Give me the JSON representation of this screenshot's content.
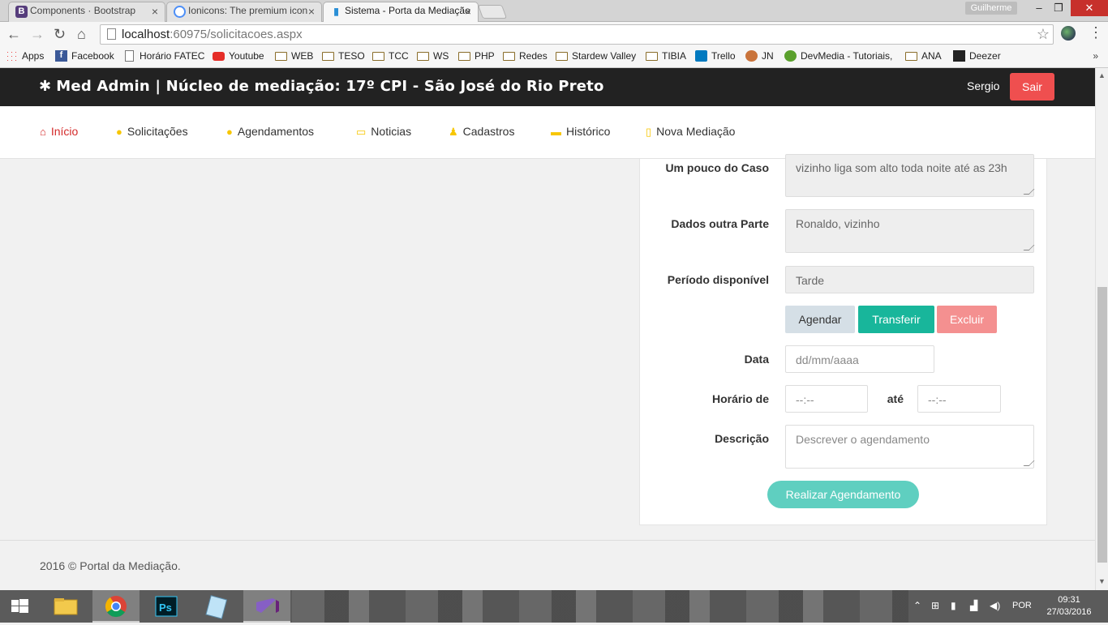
{
  "browser": {
    "tabs": [
      {
        "title": "Components · Bootstrap",
        "favicon": "B",
        "favicon_color": "#563d7c"
      },
      {
        "title": "Ionicons: The premium icon",
        "favicon": "",
        "favicon_color": "#4d8ff7"
      },
      {
        "title": "Sistema - Porta da Mediação",
        "favicon": "",
        "favicon_color": "#2a8fd6"
      }
    ],
    "user_profile": "Guilherme",
    "url_host": "localhost",
    "url_path": ":60975/solicitacoes.aspx",
    "bookmarks": [
      {
        "label": "Apps",
        "icon": "apps-grid-icon"
      },
      {
        "label": "Facebook",
        "icon": "facebook-icon"
      },
      {
        "label": "Horário FATEC",
        "icon": "page-icon"
      },
      {
        "label": "Youtube",
        "icon": "youtube-icon"
      },
      {
        "label": "WEB",
        "icon": "folder-icon"
      },
      {
        "label": "TESO",
        "icon": "folder-icon"
      },
      {
        "label": "TCC",
        "icon": "folder-icon"
      },
      {
        "label": "WS",
        "icon": "folder-icon"
      },
      {
        "label": "PHP",
        "icon": "folder-icon"
      },
      {
        "label": "Redes",
        "icon": "folder-icon"
      },
      {
        "label": "Stardew Valley",
        "icon": "folder-icon"
      },
      {
        "label": "TIBIA",
        "icon": "folder-icon"
      },
      {
        "label": "Trello",
        "icon": "trello-icon"
      },
      {
        "label": "JN",
        "icon": "jn-icon"
      },
      {
        "label": "DevMedia - Tutoriais,",
        "icon": "devmedia-icon"
      },
      {
        "label": "ANA",
        "icon": "folder-icon"
      },
      {
        "label": "Deezer",
        "icon": "deezer-icon"
      }
    ]
  },
  "header": {
    "brand": "Med Admin | Núcleo de mediação: 17º CPI - São José do Rio Preto",
    "user": "Sergio",
    "logout": "Sair"
  },
  "nav": {
    "items": [
      {
        "label": "Início",
        "icon": "home-icon",
        "active": true
      },
      {
        "label": "Solicitações",
        "icon": "circle-icon"
      },
      {
        "label": "Agendamentos",
        "icon": "chat-icon"
      },
      {
        "label": "Noticias",
        "icon": "calendar-icon"
      },
      {
        "label": "Cadastros",
        "icon": "users-icon"
      },
      {
        "label": "Histórico",
        "icon": "folder-icon"
      },
      {
        "label": "Nova Mediação",
        "icon": "document-icon"
      }
    ]
  },
  "form": {
    "caso_label": "Um pouco do Caso",
    "caso_value": "vizinho liga som alto toda noite até as 23h",
    "outra_parte_label": "Dados outra Parte",
    "outra_parte_value": "Ronaldo, vizinho",
    "periodo_label": "Período disponível",
    "periodo_value": "Tarde",
    "btn_agendar": "Agendar",
    "btn_transferir": "Transferir",
    "btn_excluir": "Excluir",
    "data_label": "Data",
    "data_placeholder": "dd/mm/aaaa",
    "horario_label": "Horário de",
    "horario_from_placeholder": "--:--",
    "ate_label": "até",
    "horario_to_placeholder": "--:--",
    "descricao_label": "Descrição",
    "descricao_placeholder": "Descrever o agendamento",
    "btn_realizar": "Realizar Agendamento"
  },
  "footer": {
    "text": "2016 © Portal da Mediação."
  },
  "taskbar": {
    "apps": [
      "file-explorer-icon",
      "chrome-icon",
      "photoshop-icon",
      "notepad-icon",
      "visual-studio-icon"
    ],
    "language": "POR",
    "time": "09:31",
    "date": "27/03/2016"
  },
  "colors": {
    "header_bg": "#222222",
    "logout": "#ef4f4f",
    "transferir": "#18b69b",
    "excluir": "#f49090",
    "realizar": "#5fcfc0",
    "active_nav": "#d42a2a",
    "nav_icon": "#f7c600"
  }
}
